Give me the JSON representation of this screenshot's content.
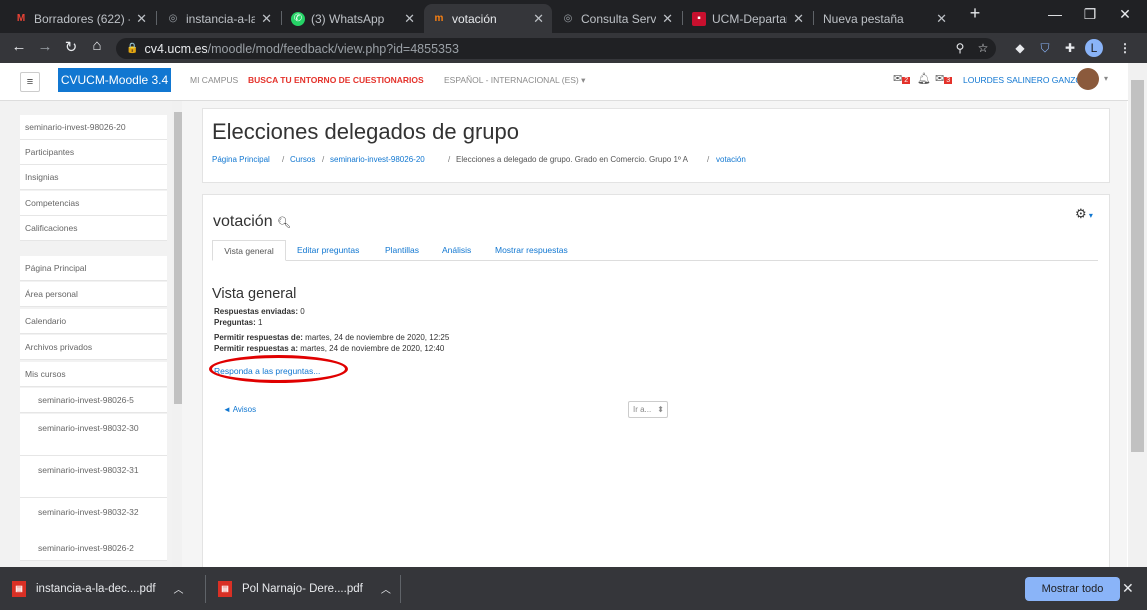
{
  "browser": {
    "tabs": [
      {
        "title": "Borradores (622) -",
        "icon": "gmail-icon",
        "fav_color": "#ea4335",
        "fav_glyph": "M",
        "active": false
      },
      {
        "title": "instancia-a-la-dec",
        "icon": "globe-icon",
        "fav_color": "#5f6368",
        "fav_glyph": "◎",
        "active": false
      },
      {
        "title": "(3) WhatsApp",
        "icon": "whatsapp-icon",
        "fav_color": "#25d366",
        "fav_glyph": "✆",
        "active": false
      },
      {
        "title": "votación",
        "icon": "moodle-icon",
        "fav_color": "#f98012",
        "fav_glyph": "m",
        "active": true
      },
      {
        "title": "Consulta Servidor",
        "icon": "globe-icon",
        "fav_color": "#5f6368",
        "fav_glyph": "◎",
        "active": false
      },
      {
        "title": "UCM-Departamen",
        "icon": "ucm-icon",
        "fav_color": "#c8102e",
        "fav_glyph": "▪",
        "active": false
      },
      {
        "title": "Nueva pestaña",
        "icon": "",
        "fav_color": "",
        "fav_glyph": "",
        "active": false
      }
    ],
    "url_domain": "cv4.ucm.es",
    "url_path": "/moodle/mod/feedback/view.php?id=4855353",
    "profile_initial": "L"
  },
  "moodle": {
    "brand": "CVUCM-Moodle 3.4",
    "nav": {
      "campus": "MI CAMPUS",
      "find": "BUSCA TU ENTORNO DE CUESTIONARIOS",
      "lang": "ESPAÑOL - INTERNACIONAL (ES) ▾",
      "user": "LOURDES SALINERO GANZO"
    },
    "sidebar": [
      "seminario-invest-98026-20",
      "Participantes",
      "Insignias",
      "Competencias",
      "Calificaciones",
      "Página Principal",
      "Área personal",
      "Calendario",
      "Archivos privados",
      "Mis cursos",
      "seminario-invest-98026-5",
      "seminario-invest-98032-30",
      "seminario-invest-98032-31",
      "seminario-invest-98032-32",
      "seminario-invest-98026-2"
    ],
    "page_title": "Elecciones delegados de grupo",
    "breadcrumb": [
      "Página Principal",
      "Cursos",
      "seminario-invest-98026-20",
      "Elecciones a delegado de grupo. Grado en Comercio. Grupo 1º A",
      "votación"
    ],
    "activity_title": "votación",
    "tabs": [
      "Vista general",
      "Editar preguntas",
      "Plantillas",
      "Análisis",
      "Mostrar respuestas"
    ],
    "section_heading": "Vista general",
    "info": {
      "enviadas_label": "Respuestas enviadas:",
      "enviadas_value": "0",
      "preguntas_label": "Preguntas:",
      "preguntas_value": "1",
      "desde_label": "Permitir respuestas de:",
      "desde_value": "martes, 24 de noviembre de 2020, 12:25",
      "hasta_label": "Permitir respuestas a:",
      "hasta_value": "martes, 24 de noviembre de 2020, 12:40"
    },
    "respond_link": "Responda a las preguntas...",
    "prev_link": "◄ Avisos",
    "jump_select": "Ir a...",
    "accent": "#1177d1"
  },
  "downloads": {
    "files": [
      "instancia-a-la-dec....pdf",
      "Pol Narnajo- Dere....pdf"
    ],
    "show_all": "Mostrar todo"
  }
}
